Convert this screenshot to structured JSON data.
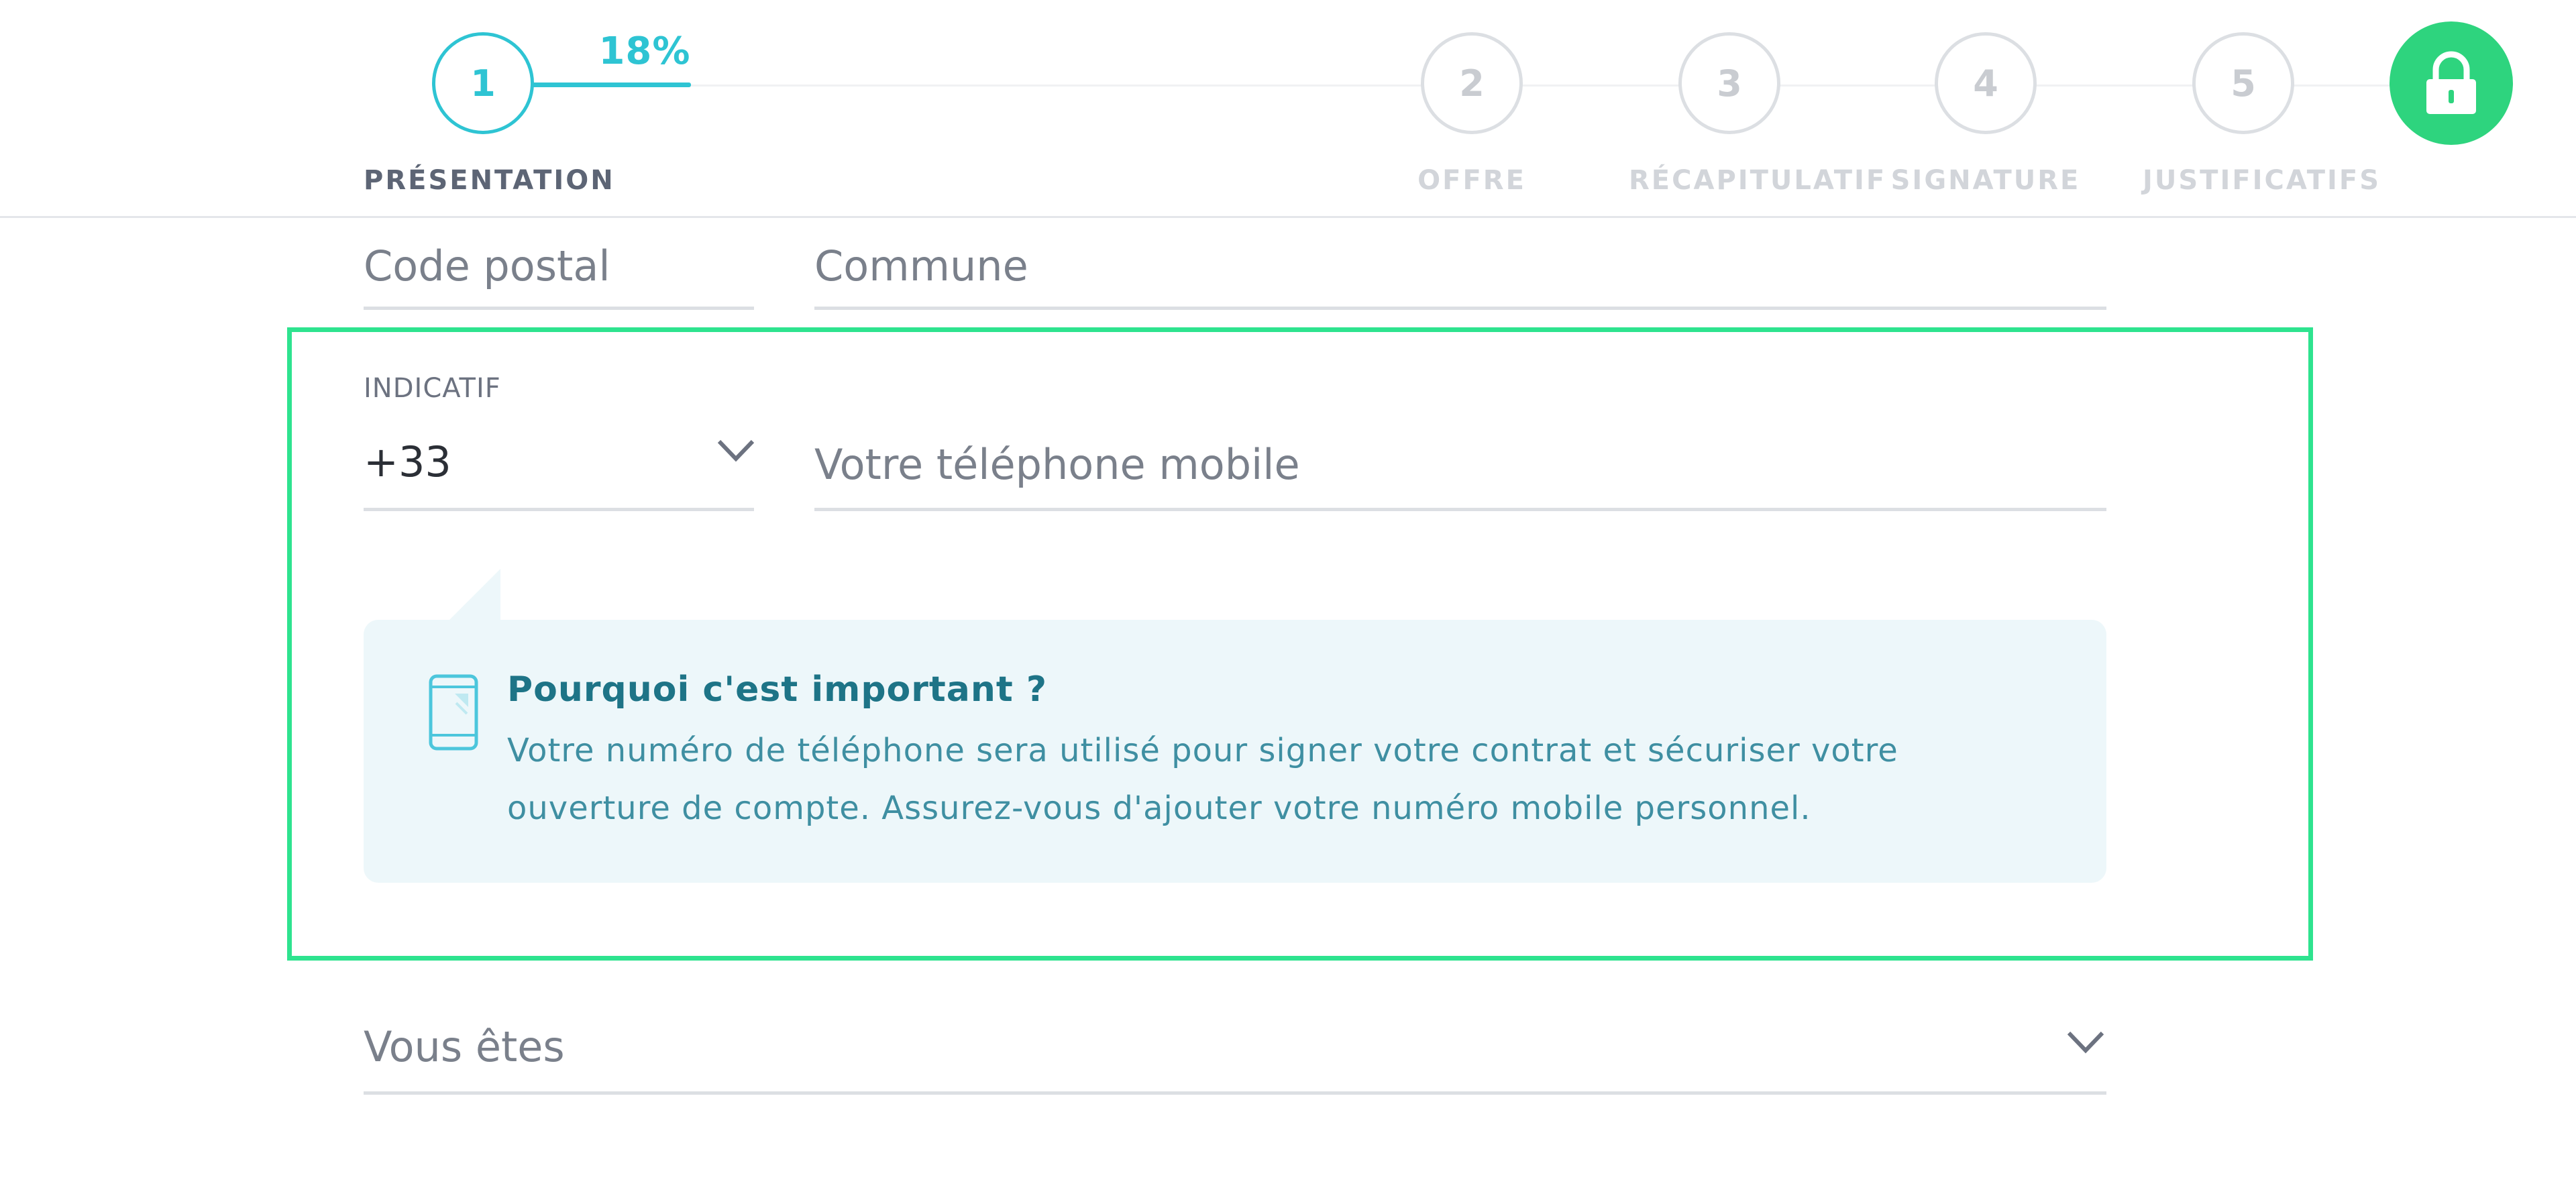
{
  "stepper": {
    "progress_percent": 18,
    "progress_label": "18%",
    "steps": [
      {
        "number": "1",
        "label": "PRÉSENTATION",
        "state": "active"
      },
      {
        "number": "2",
        "label": "OFFRE",
        "state": "upcoming"
      },
      {
        "number": "3",
        "label": "RÉCAPITULATIF",
        "state": "upcoming"
      },
      {
        "number": "4",
        "label": "SIGNATURE",
        "state": "upcoming"
      },
      {
        "number": "5",
        "label": "JUSTIFICATIFS",
        "state": "upcoming"
      }
    ],
    "lock_icon": "lock-icon"
  },
  "form": {
    "postal_code": {
      "placeholder": "Code postal",
      "value": ""
    },
    "commune": {
      "placeholder": "Commune",
      "value": ""
    },
    "country_code": {
      "label": "INDICATIF",
      "value": "+33"
    },
    "mobile_phone": {
      "placeholder": "Votre téléphone mobile",
      "value": ""
    },
    "status_select": {
      "placeholder": "Vous êtes",
      "value": ""
    }
  },
  "info_box": {
    "icon": "smartphone-icon",
    "title": "Pourquoi c'est important ?",
    "text_line1": "Votre numéro de téléphone sera utilisé pour signer votre contrat et sécuriser votre",
    "text_line2": "ouverture de compte. Assurez-vous d'ajouter votre numéro mobile personnel."
  },
  "colors": {
    "accent": "#2ec4d3",
    "success": "#2ed47e",
    "highlight_border": "#2ee38f",
    "info_background": "#edf7fa",
    "info_title": "#1e7487"
  }
}
